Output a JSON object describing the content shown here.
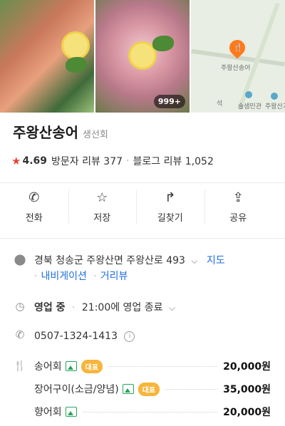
{
  "photos": {
    "count_badge": "999+"
  },
  "map": {
    "place_label": "주왕산송어",
    "poi1": "석",
    "poi2": "솔샘민관",
    "poi3": "주왕산거"
  },
  "place": {
    "name": "주왕산송어",
    "category": "생선회"
  },
  "rating": {
    "score": "4.69",
    "visitor_reviews": "방문자 리뷰 377",
    "blog_reviews": "블로그 리뷰 1,052"
  },
  "actions": [
    {
      "label": "전화",
      "icon": "phone-icon"
    },
    {
      "label": "저장",
      "icon": "star-icon"
    },
    {
      "label": "길찾기",
      "icon": "directions-icon"
    },
    {
      "label": "공유",
      "icon": "share-icon"
    }
  ],
  "address": {
    "text": "경북 청송군 주왕산면 주왕산로 493",
    "map_link": "지도",
    "navigation": "내비게이션",
    "street_view": "거리뷰"
  },
  "hours": {
    "status": "영업 중",
    "close_info": "21:00에 영업 종료"
  },
  "phone": {
    "number": "0507-1324-1413"
  },
  "menu": [
    {
      "name": "송어회",
      "badge": "대표",
      "price": "20,000원"
    },
    {
      "name": "장어구이(소금/양념)",
      "badge": "대표",
      "price": "35,000원"
    },
    {
      "name": "향어회",
      "badge": "",
      "price": "20,000원"
    }
  ],
  "colors": {
    "accent_blue": "#1f6fde",
    "star_red": "#e8453c",
    "badge_orange": "#f7b53b",
    "image_green": "#26a65b"
  }
}
